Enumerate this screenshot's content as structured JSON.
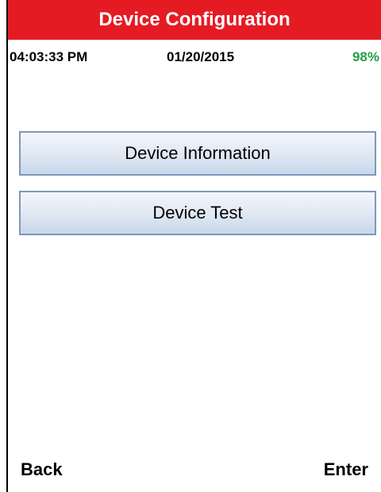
{
  "header": {
    "title": "Device Configuration",
    "title_bar_color": "#e51b24"
  },
  "status": {
    "time": "04:03:33 PM",
    "date": "01/20/2015",
    "battery": "98%",
    "battery_color": "#22a043"
  },
  "menu": {
    "items": [
      {
        "label": "Device Information"
      },
      {
        "label": "Device Test"
      }
    ]
  },
  "softkeys": {
    "left_label": "Back",
    "right_label": "Enter"
  }
}
